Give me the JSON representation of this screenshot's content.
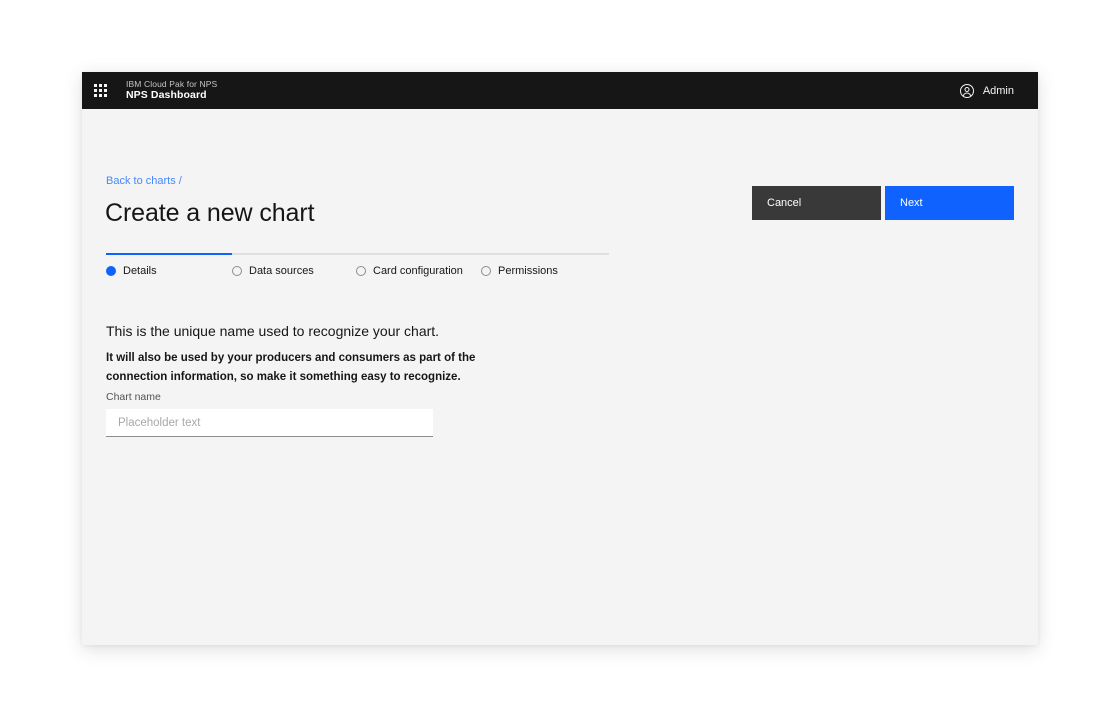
{
  "header": {
    "waffle_icon": "grid-menu-icon",
    "product_prefix": "IBM Cloud Pak for NPS",
    "product_name": "NPS Dashboard",
    "user_icon": "user-avatar-icon",
    "user_label": "Admin"
  },
  "page": {
    "breadcrumb": "Back to charts /",
    "title": "Create a new chart"
  },
  "actions": {
    "cancel_label": "Cancel",
    "next_label": "Next"
  },
  "progress": {
    "steps": [
      {
        "label": "Details",
        "state": "current"
      },
      {
        "label": "Data sources",
        "state": "incomplete"
      },
      {
        "label": "Card configuration",
        "state": "incomplete"
      },
      {
        "label": "Permissions",
        "state": "incomplete"
      }
    ]
  },
  "form": {
    "lead_text": "This is the unique name used to recognize your chart.",
    "detail_text": "It will also be used by your producers and consumers as part of the connection information, so make it something easy to recognize.",
    "chart_name_label": "Chart name",
    "chart_name_value": "",
    "chart_name_placeholder": "Placeholder text"
  },
  "colors": {
    "brand_blue": "#0f62fe",
    "link_blue": "#4589ff",
    "header_black": "#161616",
    "cancel_gray": "#393939",
    "page_background": "#f4f4f4"
  }
}
